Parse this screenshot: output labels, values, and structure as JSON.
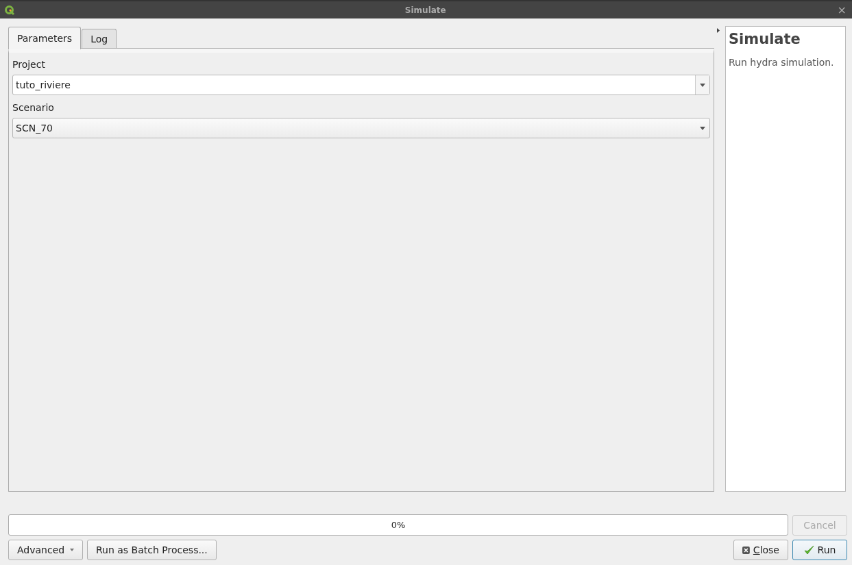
{
  "window": {
    "title": "Simulate",
    "close": "×"
  },
  "tabs": [
    {
      "label": "Parameters",
      "selected": true
    },
    {
      "label": "Log",
      "selected": false
    }
  ],
  "parameters": [
    {
      "label": "Project",
      "kind": "editable",
      "value": "tuto_riviere"
    },
    {
      "label": "Scenario",
      "kind": "combo",
      "value": "SCN_70"
    }
  ],
  "help": {
    "title": "Simulate",
    "text": "Run hydra simulation."
  },
  "progress": {
    "level": 0,
    "reading": "0%"
  },
  "cancel": {
    "label": "Cancel",
    "disabled": true
  },
  "buttons": {
    "advanced": "Advanced",
    "batch": "Run as Batch Process...",
    "close": "Close",
    "run": "Run"
  }
}
